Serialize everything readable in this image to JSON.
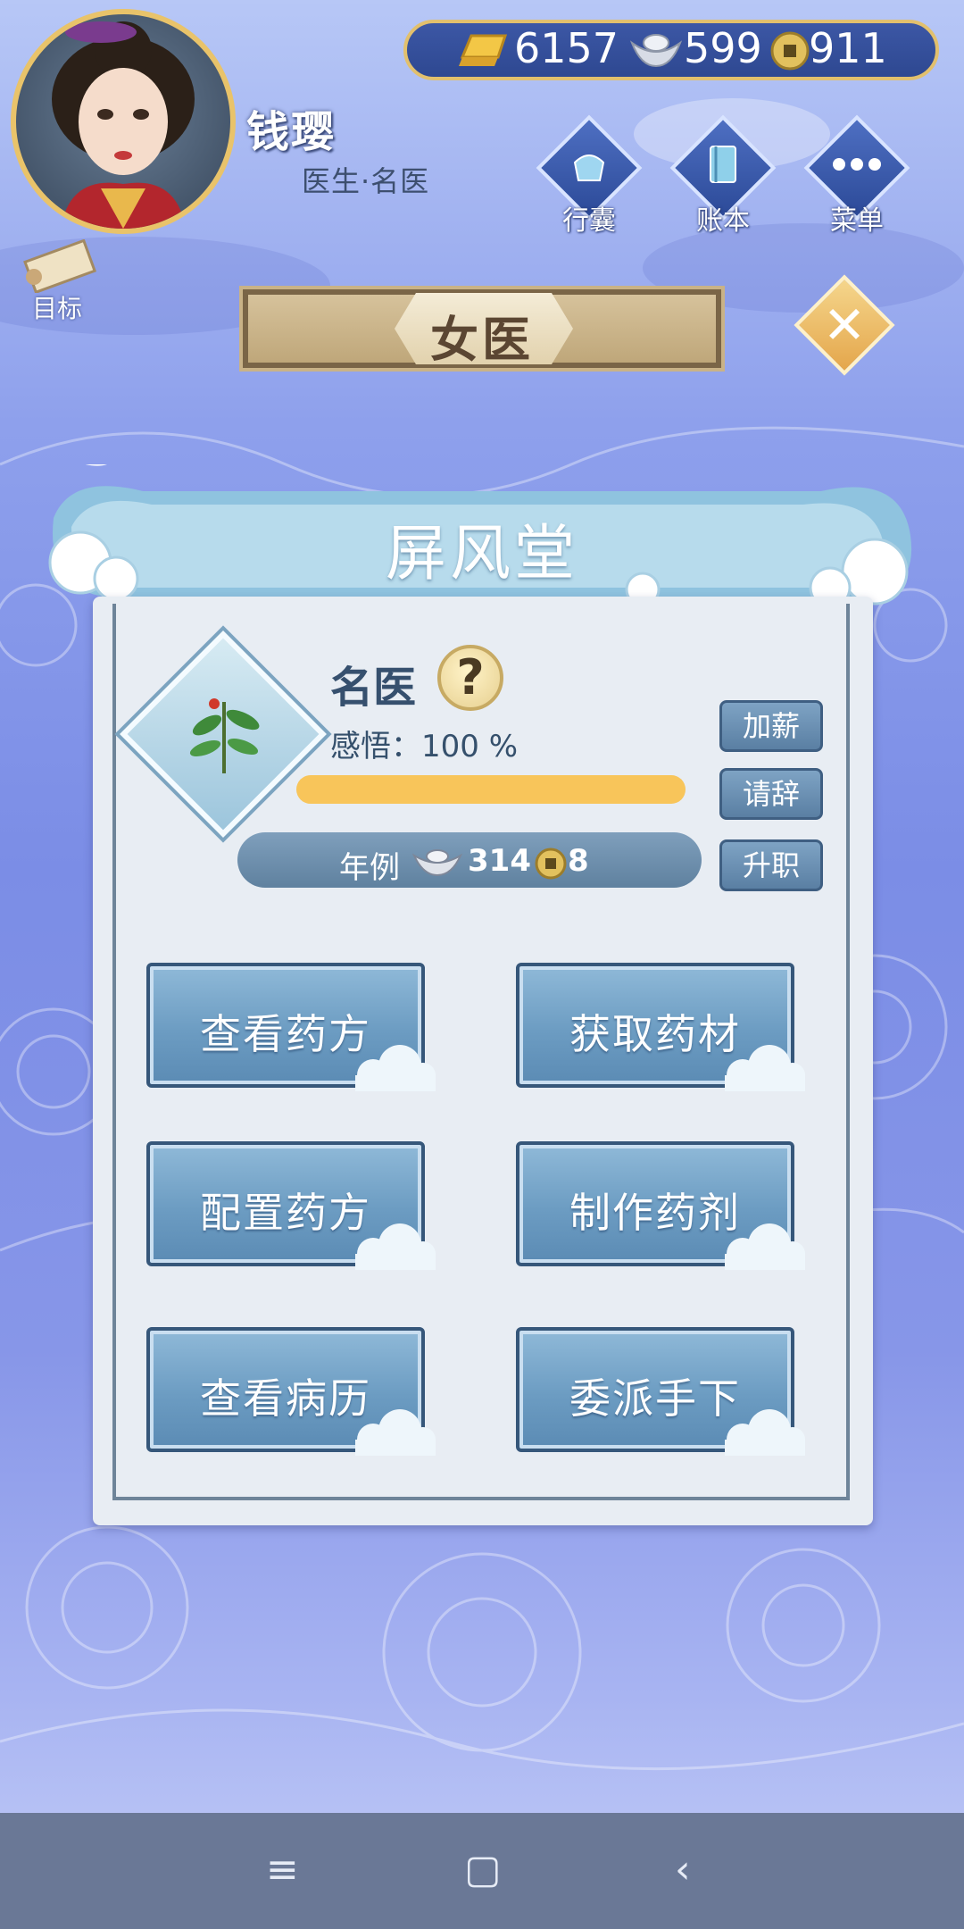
{
  "player": {
    "name": "钱璎",
    "title": "医生·名医"
  },
  "currency": {
    "gold_bar": "6157",
    "silver": "599",
    "coin": "911"
  },
  "top_menu": [
    {
      "label": "行囊",
      "icon": "bag-icon"
    },
    {
      "label": "账本",
      "icon": "ledger-icon"
    },
    {
      "label": "菜单",
      "icon": "more-icon"
    }
  ],
  "goal_label": "目标",
  "header_title": "女医",
  "location_name": "屏风堂",
  "rank": {
    "name": "名医",
    "insight_text": "感悟：100 %",
    "insight_progress": 1.0
  },
  "salary": {
    "label": "年例",
    "silver": "314",
    "coin": "8"
  },
  "side_buttons": [
    "加薪",
    "请辞",
    "升职"
  ],
  "actions": [
    "查看药方",
    "获取药材",
    "配置药方",
    "制作药剂",
    "查看病历",
    "委派手下"
  ],
  "nav": {
    "menu_icon": "≡",
    "home_icon": "▢",
    "back_icon": "‹"
  },
  "colors": {
    "accent_gold": "#e2c06d",
    "progress": "#f8c55a",
    "panel": "#e8edf3"
  }
}
